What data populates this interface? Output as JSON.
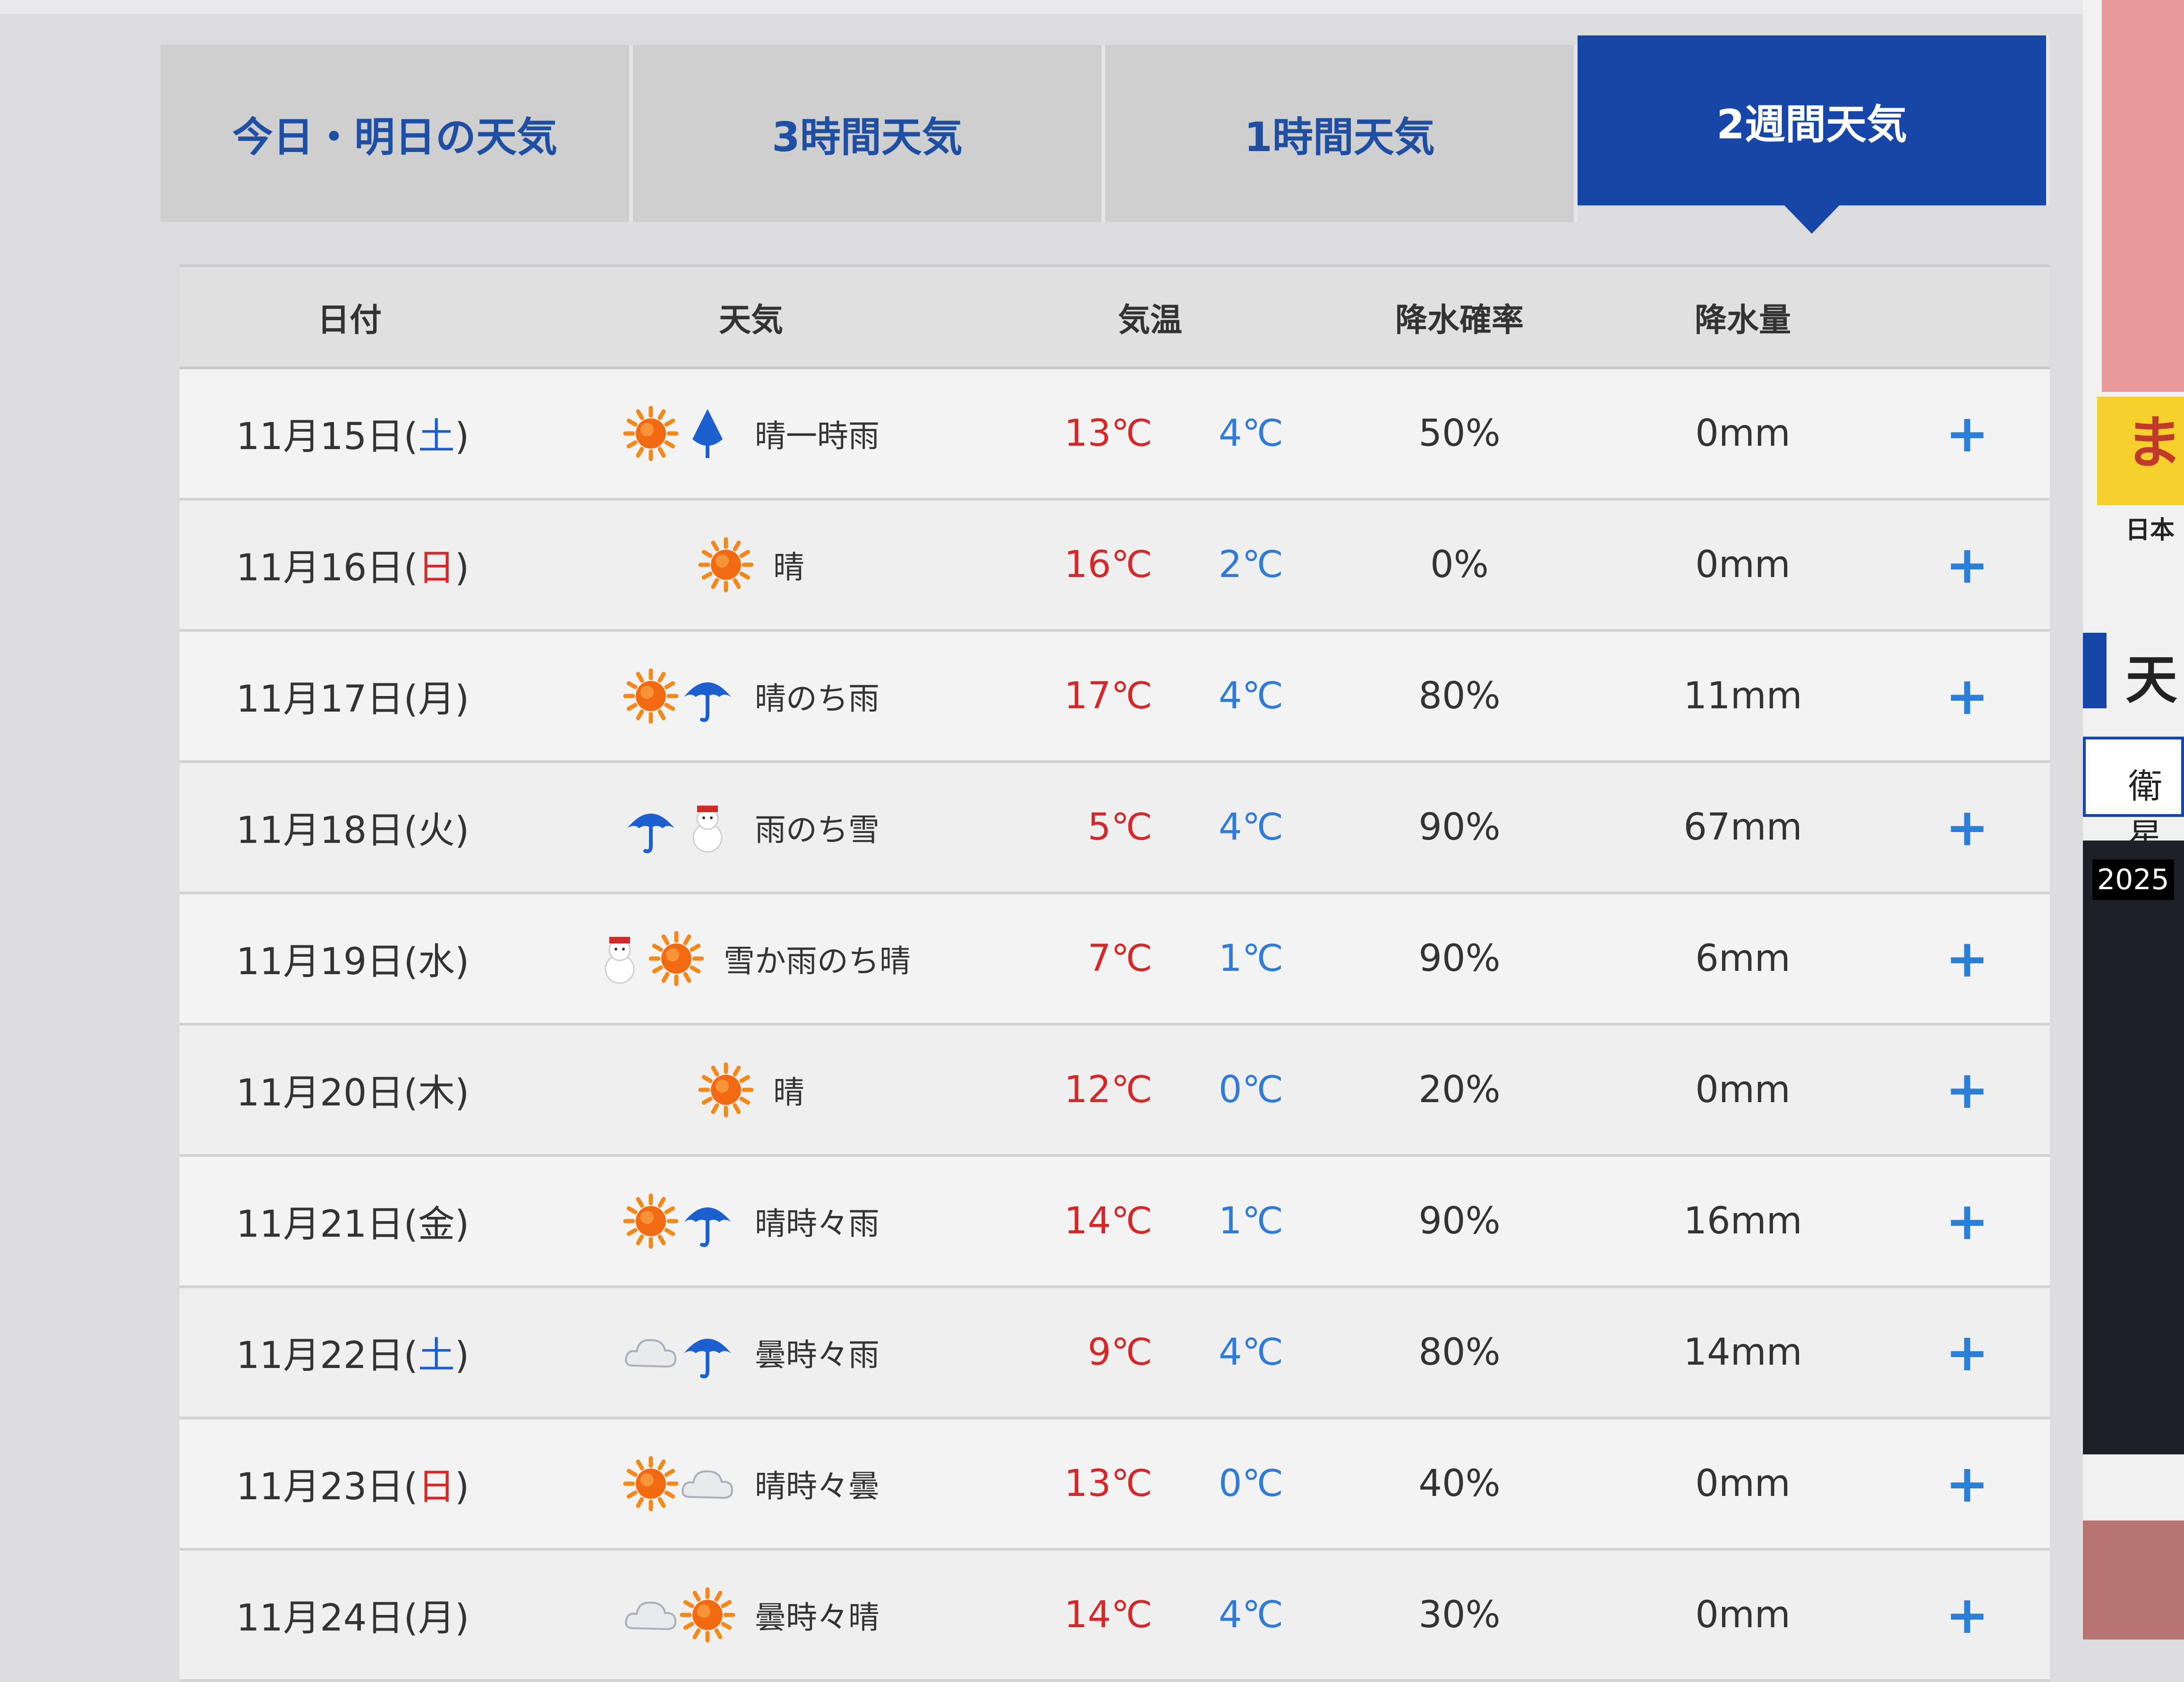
{
  "tabs": [
    {
      "label": "今日・明日の天気",
      "active": false
    },
    {
      "label": "3時間天気",
      "active": false
    },
    {
      "label": "1時間天気",
      "active": false
    },
    {
      "label": "2週間天気",
      "active": true
    }
  ],
  "table": {
    "headers": {
      "date": "日付",
      "weather": "天気",
      "temp": "気温",
      "prob": "降水確率",
      "amount": "降水量"
    },
    "rows": [
      {
        "date": "11月15日(",
        "dow": "土",
        "close": ")",
        "dow_color": "blue",
        "icons": [
          "sun-icon",
          "rain-drop-icon"
        ],
        "weather": "晴一時雨",
        "hi": "13℃",
        "lo": "4℃",
        "prob": "50%",
        "amount": "0mm"
      },
      {
        "date": "11月16日(",
        "dow": "日",
        "close": ")",
        "dow_color": "red",
        "icons": [
          "sun-icon"
        ],
        "weather": "晴",
        "hi": "16℃",
        "lo": "2℃",
        "prob": "0%",
        "amount": "0mm"
      },
      {
        "date": "11月17日(",
        "dow": "月",
        "close": ")",
        "dow_color": "none",
        "icons": [
          "sun-icon",
          "umbrella-icon"
        ],
        "weather": "晴のち雨",
        "hi": "17℃",
        "lo": "4℃",
        "prob": "80%",
        "amount": "11mm"
      },
      {
        "date": "11月18日(",
        "dow": "火",
        "close": ")",
        "dow_color": "none",
        "icons": [
          "umbrella-icon",
          "snowman-icon"
        ],
        "weather": "雨のち雪",
        "hi": "5℃",
        "lo": "4℃",
        "prob": "90%",
        "amount": "67mm"
      },
      {
        "date": "11月19日(",
        "dow": "水",
        "close": ")",
        "dow_color": "none",
        "icons": [
          "snowman-icon",
          "sun-icon"
        ],
        "weather": "雪か雨のち晴",
        "hi": "7℃",
        "lo": "1℃",
        "prob": "90%",
        "amount": "6mm"
      },
      {
        "date": "11月20日(",
        "dow": "木",
        "close": ")",
        "dow_color": "none",
        "icons": [
          "sun-icon"
        ],
        "weather": "晴",
        "hi": "12℃",
        "lo": "0℃",
        "prob": "20%",
        "amount": "0mm"
      },
      {
        "date": "11月21日(",
        "dow": "金",
        "close": ")",
        "dow_color": "none",
        "icons": [
          "sun-icon",
          "umbrella-icon"
        ],
        "weather": "晴時々雨",
        "hi": "14℃",
        "lo": "1℃",
        "prob": "90%",
        "amount": "16mm"
      },
      {
        "date": "11月22日(",
        "dow": "土",
        "close": ")",
        "dow_color": "blue",
        "icons": [
          "cloud-icon",
          "umbrella-icon"
        ],
        "weather": "曇時々雨",
        "hi": "9℃",
        "lo": "4℃",
        "prob": "80%",
        "amount": "14mm"
      },
      {
        "date": "11月23日(",
        "dow": "日",
        "close": ")",
        "dow_color": "red",
        "icons": [
          "sun-icon",
          "cloud-icon"
        ],
        "weather": "晴時々曇",
        "hi": "13℃",
        "lo": "0℃",
        "prob": "40%",
        "amount": "0mm"
      },
      {
        "date": "11月24日(",
        "dow": "月",
        "close": ")",
        "dow_color": "none",
        "icons": [
          "cloud-icon",
          "sun-icon"
        ],
        "weather": "曇時々晴",
        "hi": "14℃",
        "lo": "4℃",
        "prob": "30%",
        "amount": "0mm"
      }
    ],
    "expand_label": "+"
  },
  "sidebar": {
    "ad_text": "ま",
    "ad_caption": "日本",
    "section_title": "天",
    "button_label": "衛星",
    "map_date": "2025"
  },
  "colors": {
    "tab_active": "#1846a8",
    "temp_high": "#d22a2a",
    "temp_low": "#2f7bd6",
    "plus": "#2a7fd9"
  }
}
